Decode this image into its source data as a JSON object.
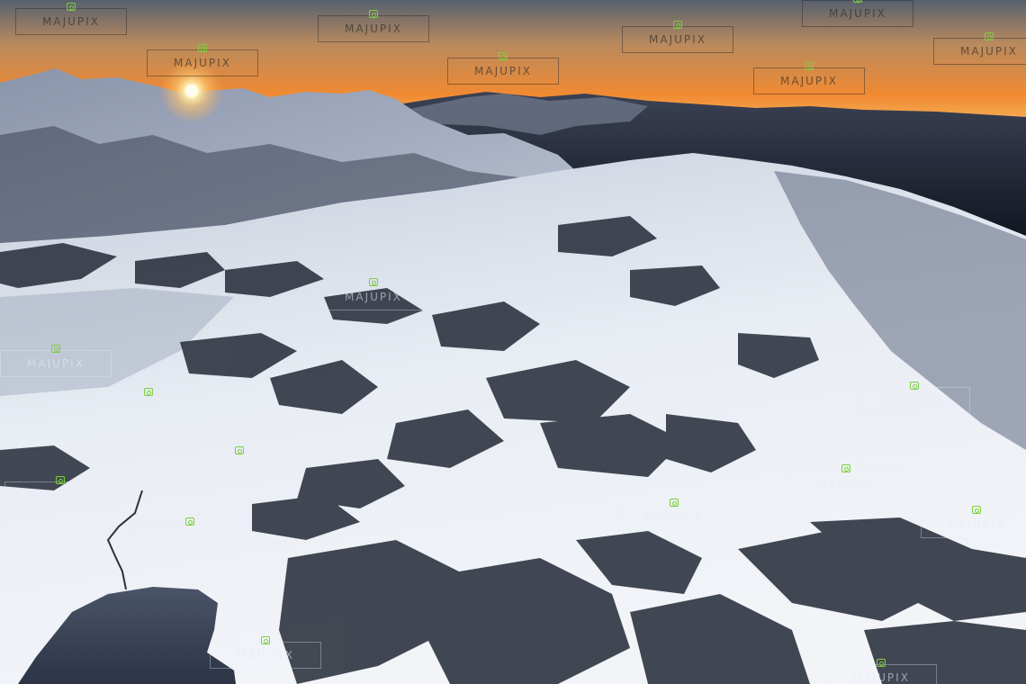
{
  "watermark": {
    "text": "MAJUPIX",
    "icon": "camera-icon",
    "icon_color": "#7ccf3d"
  },
  "scene": {
    "colors": {
      "sky_top": "#4b5565",
      "sky_glow": "#f08a32",
      "horizon": "#f6b35a",
      "sun": "#fff6d0",
      "distant_ridge": "#1c2230",
      "snow_light": "#eef1f7",
      "snow_shadow": "#7f8aa3",
      "rock": "#222833"
    }
  }
}
